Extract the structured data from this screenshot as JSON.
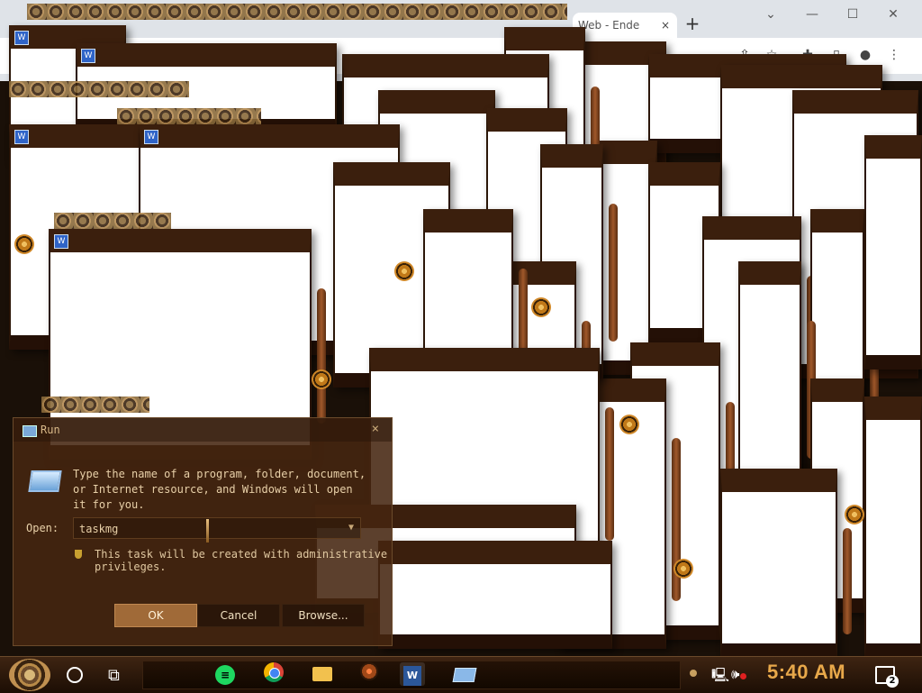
{
  "browser": {
    "tab_fragment": "Web - Ende",
    "tab_close": "×",
    "new_tab": "+",
    "controls": {
      "chevron": "⌄",
      "minimize": "—",
      "maximize": "☐",
      "close": "✕"
    },
    "toolbar_icons": [
      "share-icon",
      "star-icon",
      "extensions-icon",
      "sidebar-icon",
      "profile-icon",
      "menu-icon"
    ]
  },
  "run_dialog": {
    "title": "Run",
    "close": "×",
    "description": "Type the name of a program, folder, document, or Internet resource, and Windows will open it for you.",
    "open_label": "Open:",
    "open_value": "taskmg",
    "admin_note": "This task will be created with administrative privileges.",
    "buttons": {
      "ok": "OK",
      "cancel": "Cancel",
      "browse": "Browse..."
    }
  },
  "taskbar": {
    "apps": [
      "Spotify",
      "Google Chrome",
      "File Explorer",
      "Gears",
      "Microsoft Word",
      "Run"
    ],
    "spotify_glyph": "≡",
    "word_glyph": "W",
    "time": "5:40 AM",
    "notification_count": "2"
  },
  "colors": {
    "accent": "#e8a84a",
    "titlebar": "#3b1f0d",
    "dialog_bg": "#46261",
    "ok_button": "#a06a38"
  }
}
